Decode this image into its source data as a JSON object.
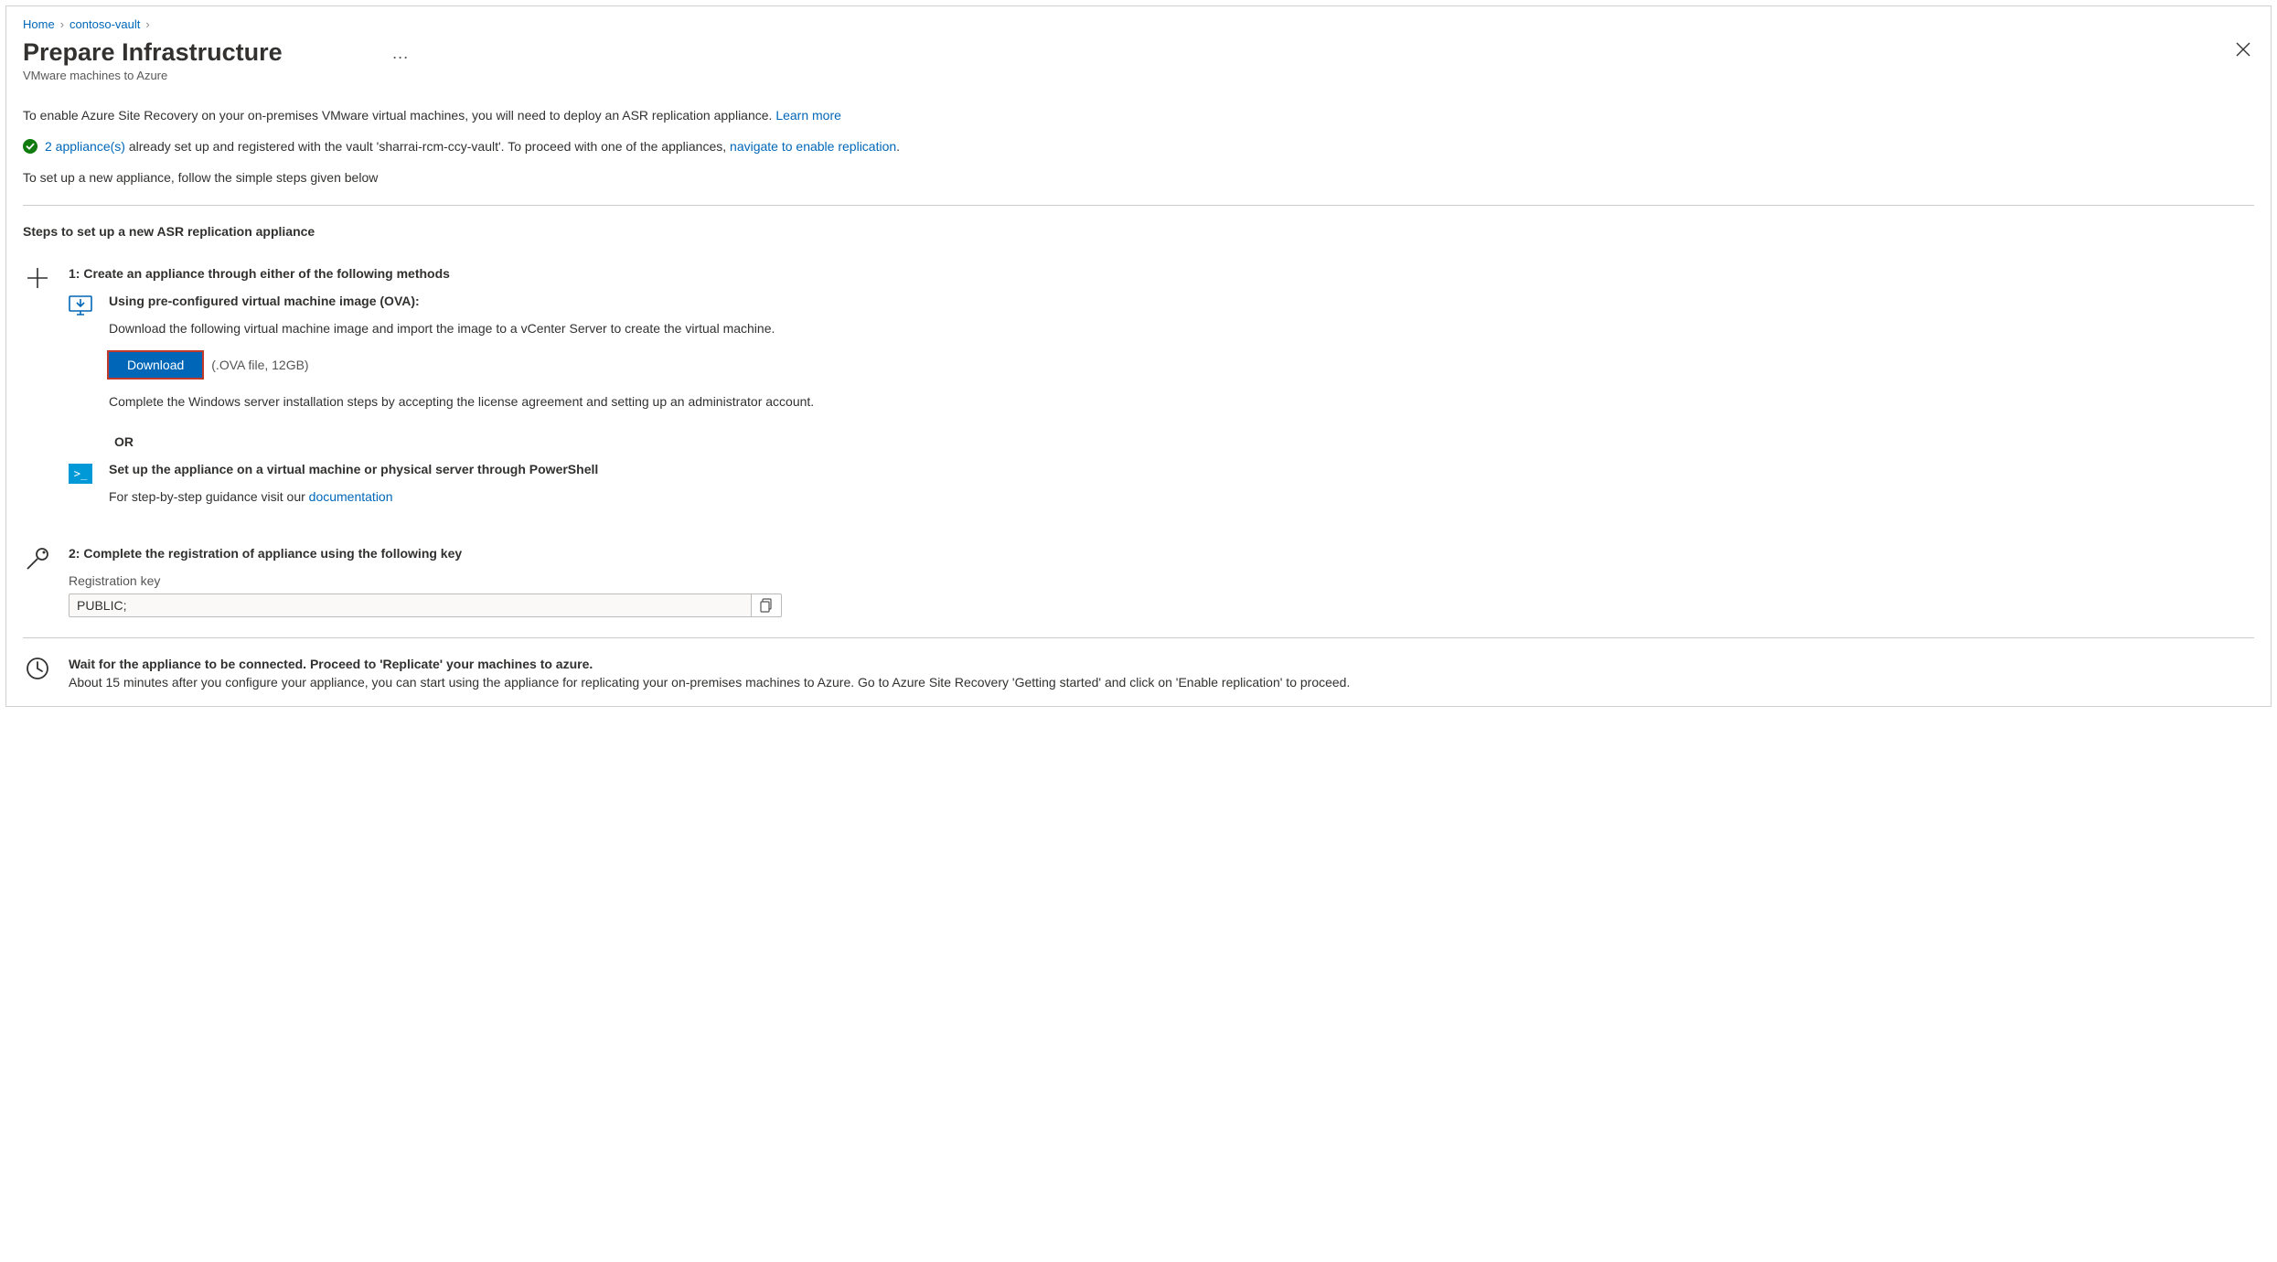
{
  "breadcrumb": {
    "home": "Home",
    "vault": "contoso-vault"
  },
  "header": {
    "title": "Prepare Infrastructure",
    "subtitle": "VMware machines to Azure"
  },
  "intro": {
    "text": "To enable Azure Site Recovery on your on-premises VMware virtual machines, you will need to deploy an ASR replication appliance.",
    "learn_more": "Learn more"
  },
  "status": {
    "link1": "2 appliance(s)",
    "mid": " already set up and registered with the vault 'sharrai-rcm-ccy-vault'. To proceed with one of the appliances, ",
    "link2": "navigate to enable replication",
    "tail": "."
  },
  "setup_new_text": "To set up a new appliance, follow the simple steps given below",
  "steps_header": "Steps to set up a new ASR replication appliance",
  "step1": {
    "title": "1: Create an appliance through either of the following methods",
    "ova": {
      "title": "Using pre-configured virtual machine image (OVA):",
      "desc": "Download the following virtual machine image and import the image to a vCenter Server to create the virtual machine.",
      "button": "Download",
      "file_hint": "(.OVA file, 12GB)",
      "complete": "Complete the Windows server installation steps by accepting the license agreement and setting up an administrator account."
    },
    "or": "OR",
    "ps": {
      "title": "Set up the appliance on a virtual machine or physical server through PowerShell",
      "desc_prefix": "For step-by-step guidance visit our ",
      "doc_link": "documentation"
    }
  },
  "step2": {
    "title": "2: Complete the registration of appliance using the following key",
    "label": "Registration key",
    "value": "PUBLIC;"
  },
  "wait": {
    "title": "Wait for the appliance to be connected. Proceed to 'Replicate' your machines to azure.",
    "desc": "About 15 minutes after you configure your appliance, you can start using the appliance for replicating your on-premises machines to Azure. Go to Azure Site Recovery 'Getting started' and click on 'Enable replication' to proceed."
  }
}
